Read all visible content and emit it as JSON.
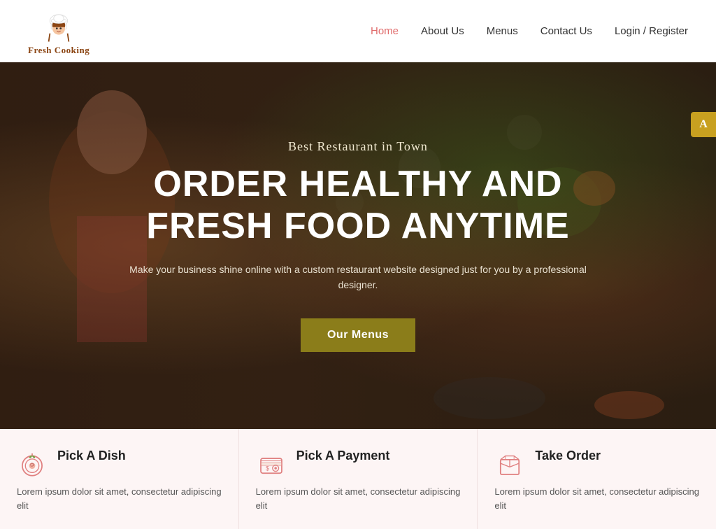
{
  "header": {
    "logo_text": "Fresh Cooking",
    "nav_items": [
      {
        "label": "Home",
        "active": true
      },
      {
        "label": "About Us",
        "active": false
      },
      {
        "label": "Menus",
        "active": false
      },
      {
        "label": "Contact Us",
        "active": false
      },
      {
        "label": "Login / Register",
        "active": false
      }
    ]
  },
  "hero": {
    "subtitle": "Best Restaurant in Town",
    "title": "ORDER HEALTHY AND FRESH FOOD ANYTIME",
    "description": "Make your business shine online with a custom restaurant website designed just for you by a professional designer.",
    "cta_label": "Our Menus"
  },
  "features": [
    {
      "title": "Pick A Dish",
      "description": "Lorem ipsum dolor sit amet, consectetur adipiscing elit",
      "icon": "dish"
    },
    {
      "title": "Pick A Payment",
      "description": "Lorem ipsum dolor sit amet, consectetur adipiscing elit",
      "icon": "payment"
    },
    {
      "title": "Take Order",
      "description": "Lorem ipsum dolor sit amet, consectetur adipiscing elit",
      "icon": "order"
    }
  ],
  "accessibility": {
    "label": "A"
  }
}
